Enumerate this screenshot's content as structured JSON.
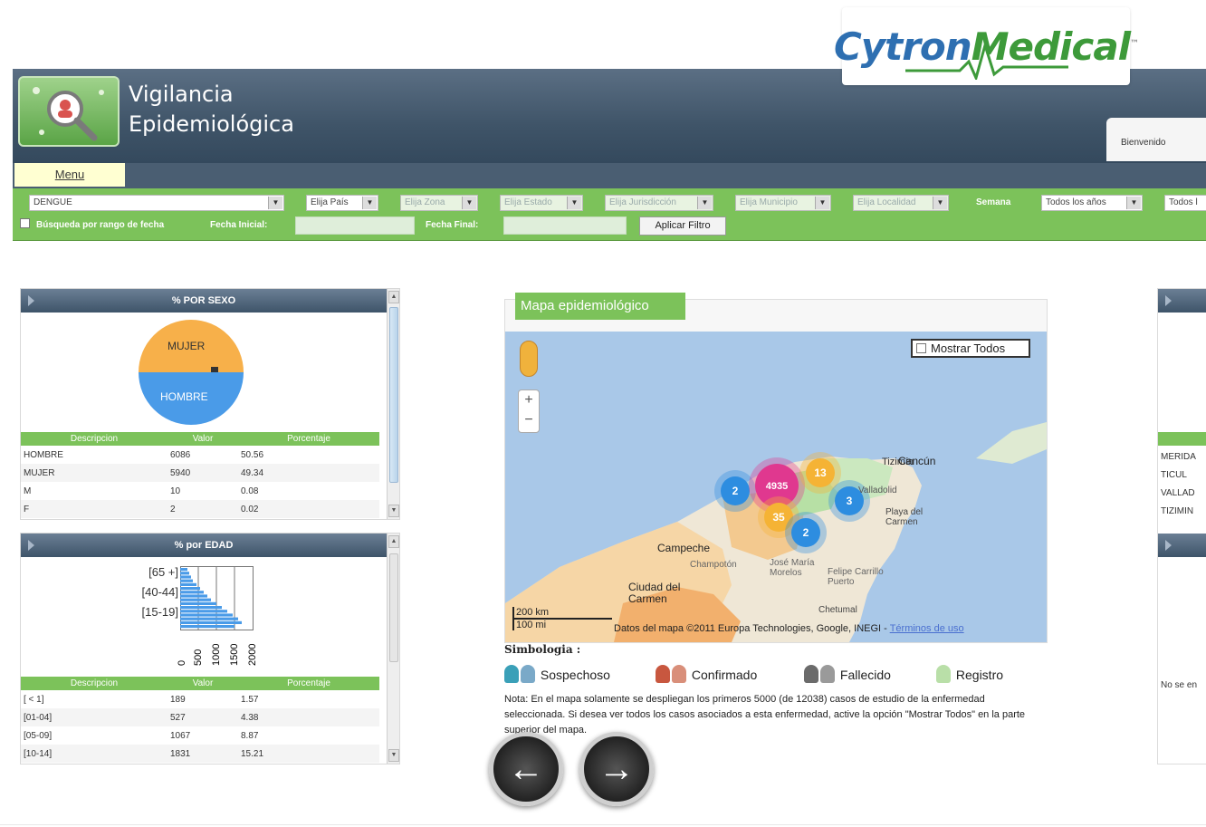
{
  "brand": {
    "part1": "Cytron",
    "part2": "Medical",
    "tm": "™"
  },
  "header": {
    "title_line1": "Vigilancia",
    "title_line2": "Epidemiológica",
    "welcome": "Bienvenido"
  },
  "menu": {
    "label": "Menu"
  },
  "filters": {
    "disease": "DENGUE",
    "country": "Elija País",
    "zone": "Elija Zona",
    "state": "Elija Estado",
    "jurisdiction": "Elija Jurisdicción",
    "municipality": "Elija Municipio",
    "locality": "Elija Localidad",
    "week_label": "Semana",
    "year": "Todos los años",
    "extra": "Todos l",
    "date_range_label": "Búsqueda por rango de fecha",
    "start_label": "Fecha Inicial:",
    "end_label": "Fecha Final:",
    "apply": "Aplicar Filtro"
  },
  "sex_panel": {
    "title": "% POR SEXO",
    "pie_labels": {
      "top": "MUJER",
      "bottom": "HOMBRE"
    },
    "columns": [
      "Descripcion",
      "Valor",
      "Porcentaje"
    ],
    "rows": [
      [
        "HOMBRE",
        "6086",
        "50.56"
      ],
      [
        "MUJER",
        "5940",
        "49.34"
      ],
      [
        "M",
        "10",
        "0.08"
      ],
      [
        "F",
        "2",
        "0.02"
      ]
    ]
  },
  "age_panel": {
    "title": "% por EDAD",
    "y_labels": [
      "[65 +]",
      "[40-44]",
      "[15-19]"
    ],
    "x_labels": [
      "0",
      "500",
      "1000",
      "1500",
      "2000"
    ],
    "columns": [
      "Descripcion",
      "Valor",
      "Porcentaje"
    ],
    "rows": [
      [
        "[ < 1]",
        "189",
        "1.57"
      ],
      [
        "[01-04]",
        "527",
        "4.38"
      ],
      [
        "[05-09]",
        "1067",
        "8.87"
      ],
      [
        "[10-14]",
        "1831",
        "15.21"
      ]
    ]
  },
  "map": {
    "title": "Mapa epidemiológico",
    "show_all": "Mostrar Todos",
    "zoom_in": "+",
    "zoom_out": "−",
    "clusters": [
      "2",
      "4935",
      "13",
      "35",
      "3",
      "2"
    ],
    "places": [
      "Tizimín",
      "Cancún",
      "Valladolid",
      "Playa del Carmen",
      "Campeche",
      "Champotón",
      "José María Morelos",
      "Felipe Carrillo Puerto",
      "Ciudad del Carmen",
      "Chetumal"
    ],
    "scale_km": "200 km",
    "scale_mi": "100 mi",
    "attribution": "Datos del mapa ©2011 Europa Technologies, Google, INEGI -",
    "terms": "Términos de uso"
  },
  "legend": {
    "title": "Simbologia :",
    "items": [
      "Sospechoso",
      "Confirmado",
      "Fallecido",
      "Registro"
    ],
    "note": "Nota: En el mapa solamente se despliegan los primeros 5000 (de 12038) casos de estudio de la enfermedad seleccionada. Si desea ver todos los casos asociados a esta enfermedad, active la opción \"Mostrar Todos\" en la parte superior del mapa."
  },
  "right_panel": {
    "rows": [
      "MERIDA",
      "TICUL",
      "VALLAD",
      "TIZIMIN"
    ],
    "empty_note": "No se en"
  },
  "nav": {
    "prev": "←",
    "next": "→"
  },
  "colors": {
    "green": "#7cc25a",
    "header": "#3f5468",
    "pink": "#e0388f",
    "orange": "#f5b335",
    "blue": "#2d8de0",
    "female": "#f7b04a",
    "male": "#4a9be8"
  }
}
